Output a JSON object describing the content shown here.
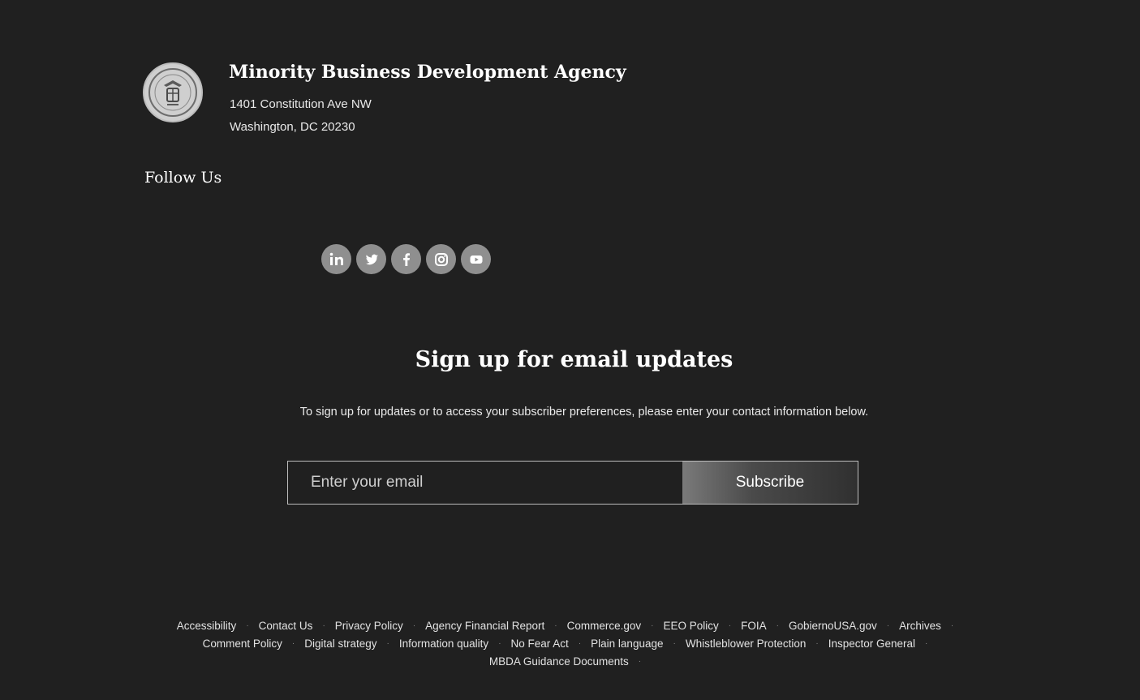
{
  "agency": {
    "name": "Minority Business Development Agency",
    "address_line1": "1401 Constitution Ave NW",
    "address_line2": "Washington, DC 20230"
  },
  "follow": {
    "label": "Follow Us",
    "social_icons": [
      "linkedin-icon",
      "twitter-icon",
      "facebook-icon",
      "instagram-icon",
      "youtube-icon"
    ]
  },
  "signup": {
    "title": "Sign up for email updates",
    "description": "To sign up for updates or to access your subscriber preferences, please enter your contact information below.",
    "email_placeholder": "Enter your email",
    "subscribe_label": "Subscribe"
  },
  "footer": {
    "row1": [
      "Accessibility",
      "Contact Us",
      "Privacy Policy",
      "Agency Financial Report",
      "Commerce.gov",
      "EEO Policy",
      "FOIA",
      "GobiernoUSA.gov",
      "Archives"
    ],
    "row2": [
      "Comment Policy",
      "Digital strategy",
      "Information quality",
      "No Fear Act",
      "Plain language",
      "Whistleblower Protection",
      "Inspector General"
    ],
    "row3": [
      "MBDA Guidance Documents"
    ]
  },
  "colors": {
    "background": "#202020",
    "text": "#ffffff",
    "social_button": "#8f8f8f"
  }
}
